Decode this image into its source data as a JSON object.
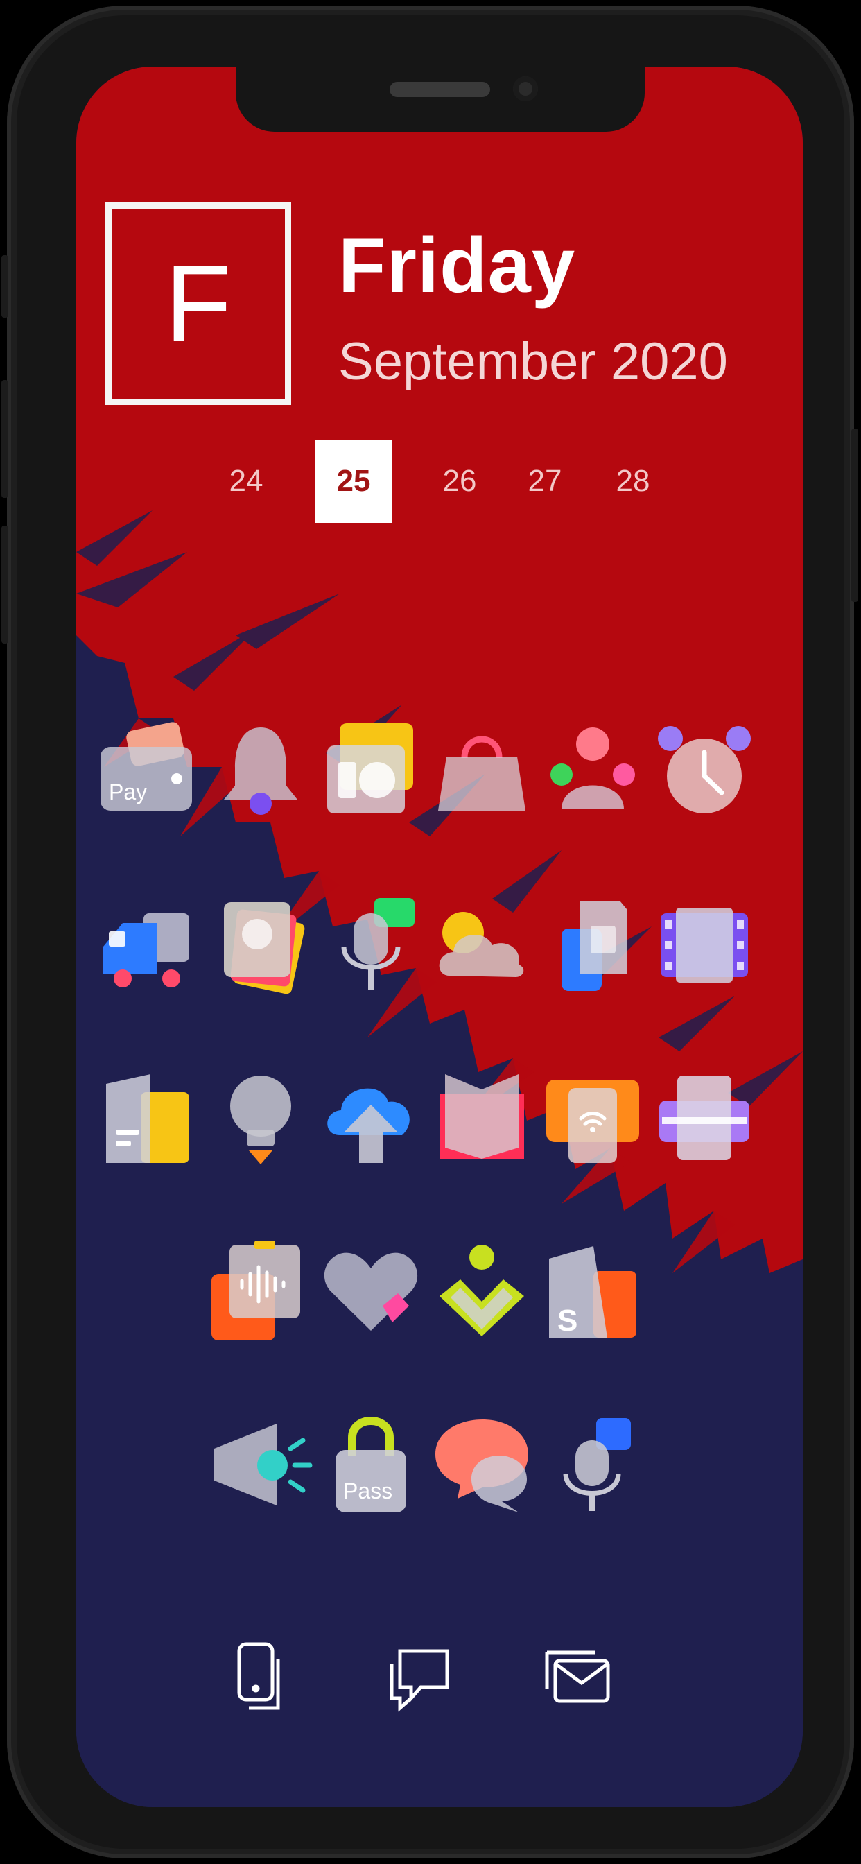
{
  "calendar": {
    "letter": "F",
    "day": "Friday",
    "month_year": "September 2020",
    "dates": [
      "24",
      "25",
      "26",
      "27",
      "28"
    ],
    "selected_date": "25"
  },
  "icons": {
    "pay_label": "Pay",
    "pass_label": "Pass",
    "s_label": "S"
  },
  "colors": {
    "wallpaper_red": "#b5080f",
    "wallpaper_navy": "#1f1f4f",
    "selected_date_text": "#a11414"
  },
  "apps": [
    [
      "pay-app-icon",
      "bell-app-icon",
      "news-app-icon",
      "shopping-bag-app-icon",
      "contacts-app-icon",
      "alarm-clock-app-icon"
    ],
    [
      "delivery-truck-app-icon",
      "photo-gallery-app-icon",
      "voice-recorder-app-icon",
      "weather-app-icon",
      "sim-card-app-icon",
      "film-app-icon"
    ],
    [
      "documents-app-icon",
      "lightbulb-app-icon",
      "cloud-upload-app-icon",
      "book-app-icon",
      "wifi-camera-app-icon",
      "printer-app-icon"
    ],
    [
      "audio-app-icon",
      "health-heart-app-icon",
      "fitness-app-icon",
      "s-app-icon"
    ],
    [
      "megaphone-app-icon",
      "pass-app-icon",
      "chat-bubbles-app-icon",
      "voice-assistant-app-icon"
    ]
  ],
  "dock": [
    "phone-icon",
    "messages-icon",
    "email-icon"
  ]
}
